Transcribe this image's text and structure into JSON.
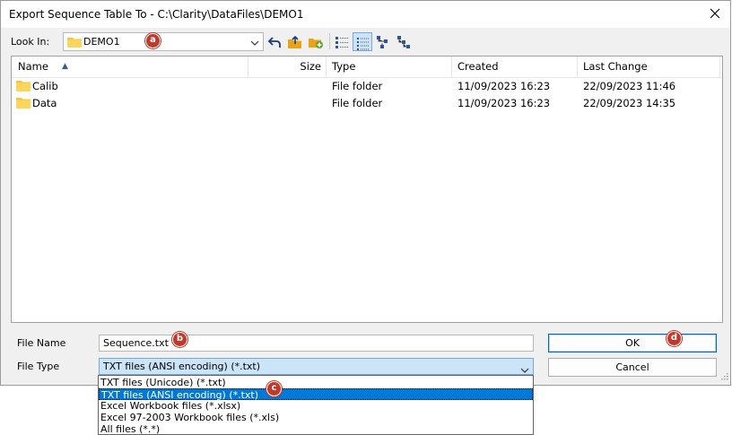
{
  "window": {
    "title": "Export Sequence Table To - C:\\Clarity\\DataFiles\\DEMO1"
  },
  "toolbar": {
    "look_in_label": "Look In:",
    "look_in_value": "DEMO1",
    "buttons": [
      {
        "icon": "back-arrow-icon"
      },
      {
        "icon": "up-one-level-icon"
      },
      {
        "icon": "new-folder-icon"
      },
      {
        "icon": "list-view-icon"
      },
      {
        "icon": "details-view-icon",
        "active": true
      },
      {
        "icon": "tree-view-icon"
      },
      {
        "icon": "tree-view-alt-icon"
      }
    ]
  },
  "file_list": {
    "columns": [
      "Name",
      "Size",
      "Type",
      "Created",
      "Last Change"
    ],
    "sort_indicator": "▲",
    "rows": [
      {
        "name": "Calib",
        "size": "",
        "type": "File folder",
        "created": "11/09/2023 16:23",
        "last_change": "22/09/2023 11:46"
      },
      {
        "name": "Data",
        "size": "",
        "type": "File folder",
        "created": "11/09/2023 16:23",
        "last_change": "22/09/2023 14:35"
      }
    ]
  },
  "form": {
    "file_name_label": "File Name",
    "file_name_value": "Sequence.txt",
    "file_type_label": "File Type",
    "file_type_value": "TXT files (ANSI encoding) (*.txt)",
    "ok_label": "OK",
    "cancel_label": "Cancel"
  },
  "file_type_options": [
    {
      "label": "TXT files (Unicode) (*.txt)",
      "selected": false
    },
    {
      "label": "TXT files (ANSI encoding) (*.txt)",
      "selected": true
    },
    {
      "label": "Excel Workbook files (*.xlsx)",
      "selected": false
    },
    {
      "label": "Excel 97-2003 Workbook files (*.xls)",
      "selected": false
    },
    {
      "label": "All files (*.*)",
      "selected": false
    }
  ],
  "callouts": {
    "a": "a",
    "b": "b",
    "c": "c",
    "d": "d"
  },
  "colors": {
    "selection": "#0078d7",
    "callout": "#c0392b",
    "folder": "#f5c542"
  }
}
